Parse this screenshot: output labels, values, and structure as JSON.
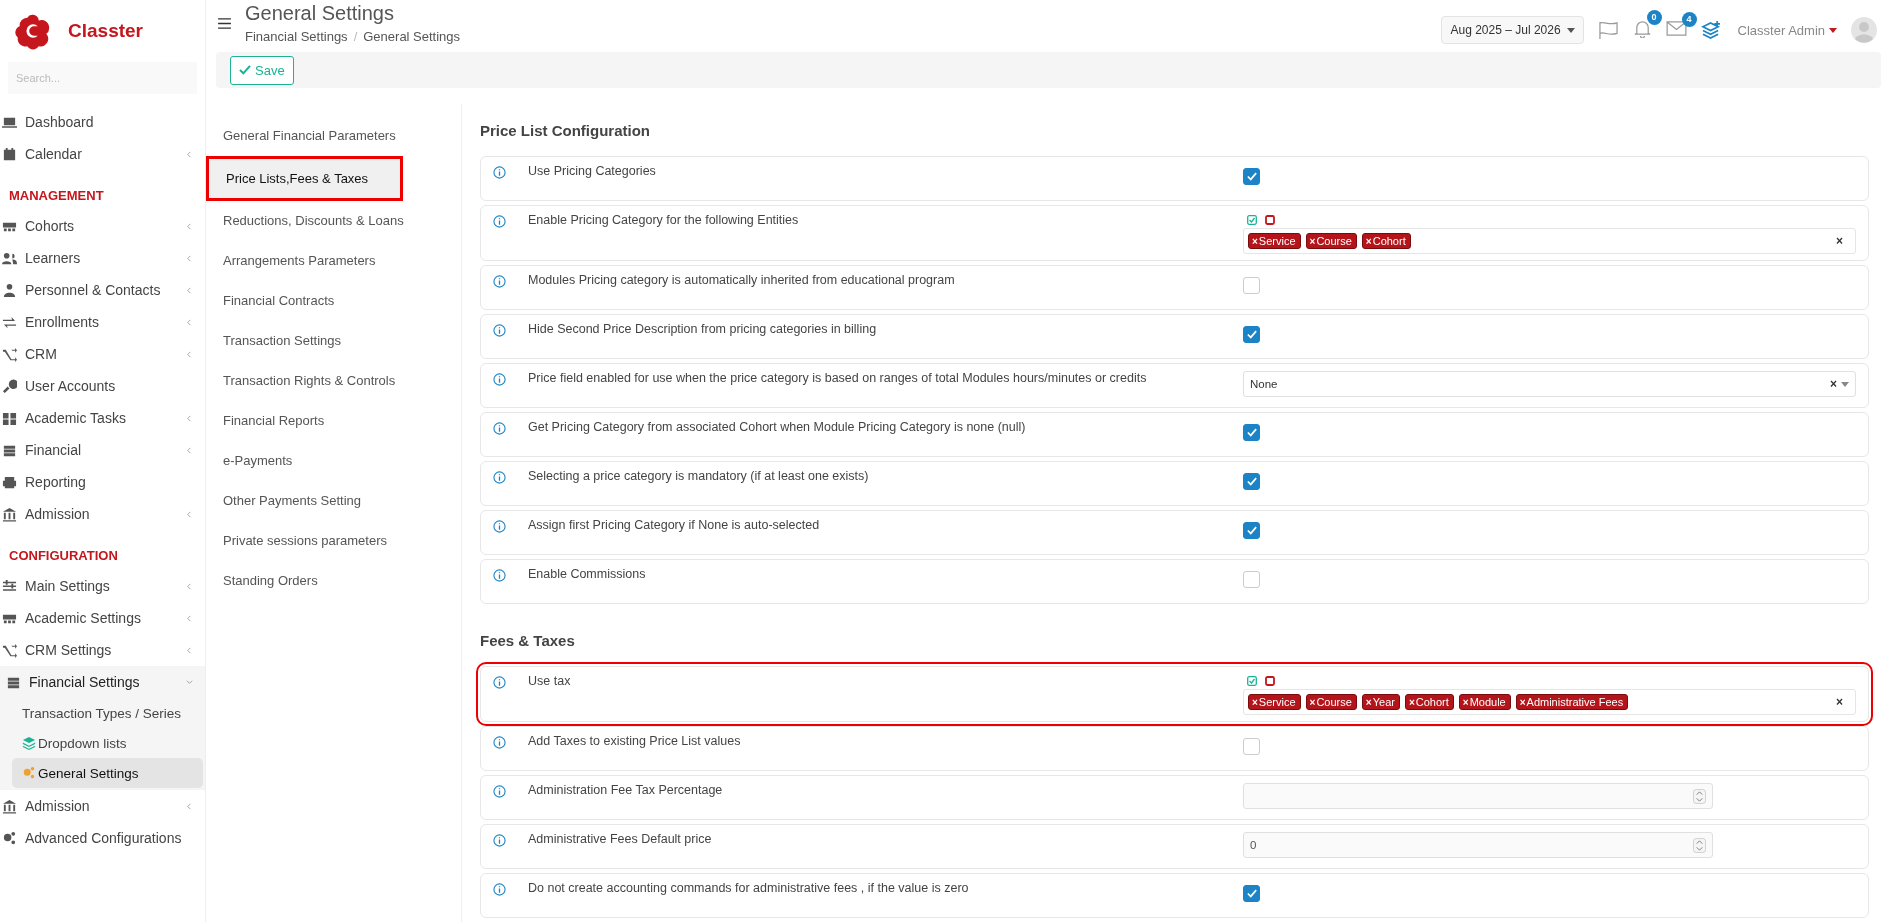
{
  "brand": {
    "name": "Classter"
  },
  "sidebar": {
    "search": {
      "placeholder": "Search..."
    },
    "groups": [
      {
        "items": [
          {
            "label": "Dashboard",
            "expandable": false,
            "expanded": false,
            "selected": false
          },
          {
            "label": "Calendar",
            "expandable": true,
            "expanded": false,
            "selected": false
          }
        ]
      },
      {
        "heading": "MANAGEMENT",
        "items": [
          {
            "label": "Cohorts",
            "expandable": true,
            "expanded": false,
            "selected": false
          },
          {
            "label": "Learners",
            "expandable": true,
            "expanded": false,
            "selected": false
          },
          {
            "label": "Personnel & Contacts",
            "expandable": true,
            "expanded": false,
            "selected": false
          },
          {
            "label": "Enrollments",
            "expandable": true,
            "expanded": false,
            "selected": false
          },
          {
            "label": "CRM",
            "expandable": true,
            "expanded": false,
            "selected": false
          },
          {
            "label": "User Accounts",
            "expandable": false,
            "expanded": false,
            "selected": false
          },
          {
            "label": "Academic Tasks",
            "expandable": true,
            "expanded": false,
            "selected": false
          },
          {
            "label": "Financial",
            "expandable": true,
            "expanded": false,
            "selected": false
          },
          {
            "label": "Reporting",
            "expandable": false,
            "expanded": false,
            "selected": false
          },
          {
            "label": "Admission",
            "expandable": true,
            "expanded": false,
            "selected": false
          }
        ]
      },
      {
        "heading": "CONFIGURATION",
        "items": [
          {
            "label": "Main Settings",
            "expandable": true,
            "expanded": false,
            "selected": false
          },
          {
            "label": "Academic Settings",
            "expandable": true,
            "expanded": false,
            "selected": false
          },
          {
            "label": "CRM Settings",
            "expandable": true,
            "expanded": false,
            "selected": false
          },
          {
            "label": "Financial Settings",
            "expandable": true,
            "expanded": true,
            "selected": false,
            "children": [
              {
                "label": "Transaction Types / Series",
                "selected": false
              },
              {
                "label": "Dropdown lists",
                "selected": false
              },
              {
                "label": "General Settings",
                "selected": true
              }
            ]
          },
          {
            "label": "Admission",
            "expandable": true,
            "expanded": false,
            "selected": false
          },
          {
            "label": "Advanced Configurations",
            "expandable": false,
            "expanded": false,
            "selected": false
          }
        ]
      }
    ]
  },
  "header": {
    "title": "General Settings",
    "breadcrumb": [
      "Financial Settings",
      "General Settings"
    ],
    "breadcrumb_separator": "/",
    "period": "Aug 2025 – Jul 2026",
    "notifications_count": "0",
    "messages_count": "4",
    "user": "Classter Admin"
  },
  "toolbar": {
    "save": "Save"
  },
  "settings_nav": [
    {
      "label": "General Financial Parameters",
      "selected": false,
      "highlighted": false
    },
    {
      "label": "Price Lists,Fees & Taxes",
      "selected": true,
      "highlighted": true
    },
    {
      "label": "Reductions, Discounts & Loans",
      "selected": false,
      "highlighted": false
    },
    {
      "label": "Arrangements Parameters",
      "selected": false,
      "highlighted": false
    },
    {
      "label": "Financial Contracts",
      "selected": false,
      "highlighted": false
    },
    {
      "label": "Transaction Settings",
      "selected": false,
      "highlighted": false
    },
    {
      "label": "Transaction Rights & Controls",
      "selected": false,
      "highlighted": false
    },
    {
      "label": "Financial Reports",
      "selected": false,
      "highlighted": false
    },
    {
      "label": "e-Payments",
      "selected": false,
      "highlighted": false
    },
    {
      "label": "Other Payments Setting",
      "selected": false,
      "highlighted": false
    },
    {
      "label": "Private sessions parameters",
      "selected": false,
      "highlighted": false
    },
    {
      "label": "Standing Orders",
      "selected": false,
      "highlighted": false
    }
  ],
  "sections": [
    {
      "title": "Price List Configuration",
      "rows": [
        {
          "kind": "checkbox",
          "label": "Use Pricing Categories",
          "checked": true,
          "highlighted": false
        },
        {
          "kind": "tags",
          "label": "Enable Pricing Category for the following Entities",
          "tags": [
            "Service",
            "Course",
            "Cohort"
          ],
          "tag_remove": "×",
          "clear": "×",
          "highlighted": false
        },
        {
          "kind": "checkbox",
          "label": "Modules Pricing category is automatically inherited from educational program",
          "checked": false,
          "highlighted": false
        },
        {
          "kind": "checkbox",
          "label": "Hide Second Price Description from pricing categories in billing",
          "checked": true,
          "highlighted": false
        },
        {
          "kind": "select",
          "label": "Price field enabled for use when the price category is based on ranges of total Modules hours/minutes or credits",
          "value": "None",
          "clear": "×",
          "highlighted": false
        },
        {
          "kind": "checkbox",
          "label": "Get Pricing Category from associated Cohort when Module Pricing Category is none (null)",
          "checked": true,
          "highlighted": false
        },
        {
          "kind": "checkbox",
          "label": "Selecting a price category is mandatory (if at least one exists)",
          "checked": true,
          "highlighted": false
        },
        {
          "kind": "checkbox",
          "label": "Assign first Pricing Category if None is auto-selected",
          "checked": true,
          "highlighted": false
        },
        {
          "kind": "checkbox",
          "label": "Enable Commissions",
          "checked": false,
          "highlighted": false
        }
      ]
    },
    {
      "title": "Fees & Taxes",
      "rows": [
        {
          "kind": "tags",
          "label": "Use tax",
          "tags": [
            "Service",
            "Course",
            "Year",
            "Cohort",
            "Module",
            "Administrative Fees"
          ],
          "tag_remove": "×",
          "clear": "×",
          "highlighted": true
        },
        {
          "kind": "checkbox",
          "label": "Add Taxes to existing Price List values",
          "checked": false,
          "highlighted": false
        },
        {
          "kind": "number",
          "label": "Administration Fee Tax Percentage",
          "highlighted": false
        },
        {
          "kind": "number",
          "label": "Administrative Fees Default price",
          "value": "0",
          "highlighted": false
        },
        {
          "kind": "checkbox",
          "label": "Do not create accounting commands for administrative fees , if the value is zero",
          "checked": true,
          "highlighted": false
        }
      ]
    }
  ]
}
